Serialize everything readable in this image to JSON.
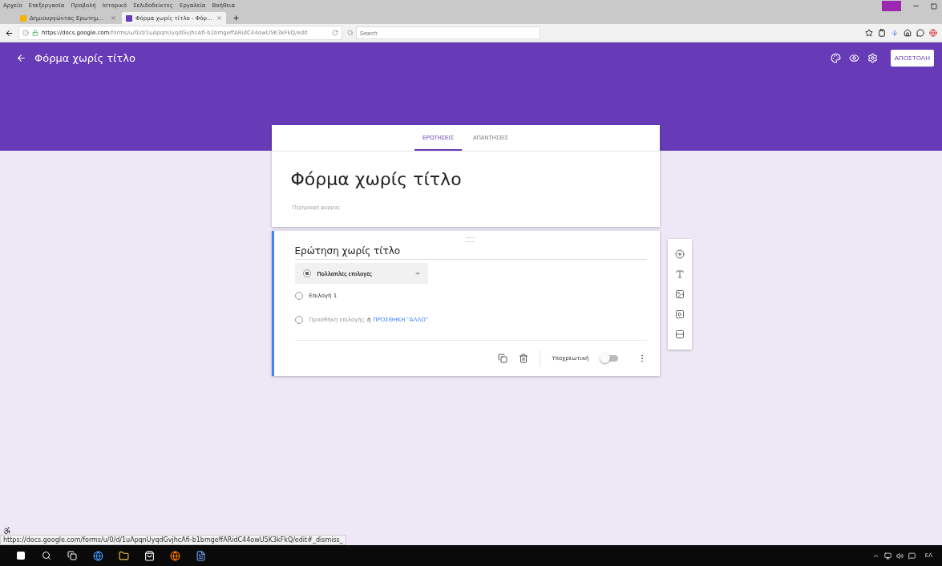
{
  "browser": {
    "menu": [
      "Αρχείο",
      "Επεξεργασία",
      "Προβολή",
      "Ιστορικό",
      "Σελιδοδείκτες",
      "Εργαλεία",
      "Βοήθεια"
    ],
    "tabs": [
      {
        "title": "Δημιουργώντας Ερωτημ...",
        "selected": false
      },
      {
        "title": "Φόρμα χωρίς τίτλο - Φόρ...",
        "selected": true
      }
    ],
    "url_host": "https://docs.google.com",
    "url_path": "/forms/u/0/d/1uApqnUyqdGvjhcAfi-b1bmgeffARidC44owU5K3kFkQ/edit",
    "search_placeholder": "Search"
  },
  "header": {
    "title": "Φόρμα χωρίς τίτλο",
    "send_button": "ΑΠΟΣΤΟΛΗ"
  },
  "form_tabs": [
    {
      "label": "ΕΡΩΤΗΣΕΙΣ",
      "selected": true
    },
    {
      "label": "ΑΠΑΝΤΗΣΕΙΣ",
      "selected": false
    }
  ],
  "form": {
    "title": "Φόρμα χωρίς τίτλο",
    "description_placeholder": "Περιγραφή φόρμας"
  },
  "question": {
    "title": "Ερώτηση χωρίς τίτλο",
    "type": "Πολλαπλές επιλογές",
    "options": [
      "Επιλογή 1"
    ],
    "add_option": "Προσθήκη επιλογής",
    "add_or": "ή",
    "add_other": "ΠΡΟΣΘΗΚΗ \"ΑΛΛΟ\"",
    "required_label": "Υποχρεωτική",
    "required": false
  },
  "status_url": "https://docs.google.com/forms/u/0/d/1uApqnUyqdGvjhcAfi-b1bmgeffARidC44owU5K3kFkQ/edit#_dismiss_",
  "taskbar": {
    "language": "ΕΛ"
  }
}
